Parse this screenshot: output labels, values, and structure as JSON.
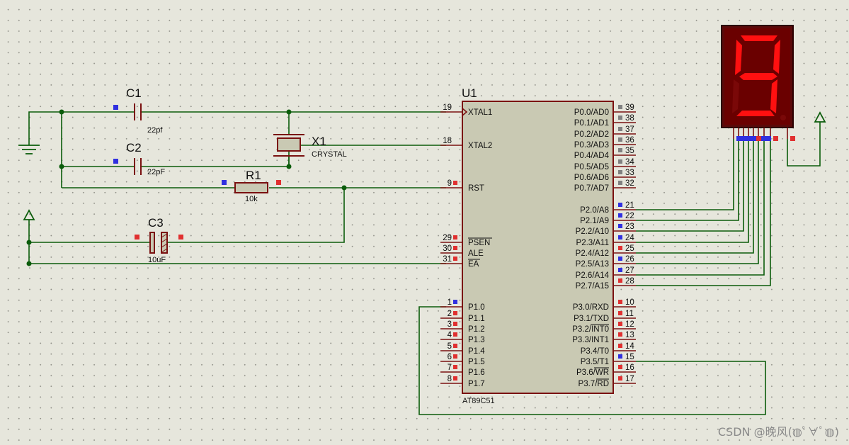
{
  "components": {
    "c1": {
      "ref": "C1",
      "value": "22pf"
    },
    "c2": {
      "ref": "C2",
      "value": "22pF"
    },
    "c3": {
      "ref": "C3",
      "value": "10uF"
    },
    "r1": {
      "ref": "R1",
      "value": "10k"
    },
    "x1": {
      "ref": "X1",
      "value": "CRYSTAL"
    },
    "u1": {
      "ref": "U1",
      "part": "AT89C51"
    }
  },
  "left_pins": [
    {
      "num": "19",
      "name": "XTAL1"
    },
    {
      "num": "18",
      "name": "XTAL2"
    },
    {
      "num": "9",
      "name": "RST"
    },
    {
      "num": "29",
      "name": "PSEN"
    },
    {
      "num": "30",
      "name": "ALE"
    },
    {
      "num": "31",
      "name": "EA"
    },
    {
      "num": "1",
      "name": "P1.0"
    },
    {
      "num": "2",
      "name": "P1.1"
    },
    {
      "num": "3",
      "name": "P1.2"
    },
    {
      "num": "4",
      "name": "P1.3"
    },
    {
      "num": "5",
      "name": "P1.4"
    },
    {
      "num": "6",
      "name": "P1.5"
    },
    {
      "num": "7",
      "name": "P1.6"
    },
    {
      "num": "8",
      "name": "P1.7"
    }
  ],
  "right_pins": [
    {
      "num": "39",
      "name": "P0.0/AD0"
    },
    {
      "num": "38",
      "name": "P0.1/AD1"
    },
    {
      "num": "37",
      "name": "P0.2/AD2"
    },
    {
      "num": "36",
      "name": "P0.3/AD3"
    },
    {
      "num": "35",
      "name": "P0.4/AD4"
    },
    {
      "num": "34",
      "name": "P0.5/AD5"
    },
    {
      "num": "33",
      "name": "P0.6/AD6"
    },
    {
      "num": "32",
      "name": "P0.7/AD7"
    },
    {
      "num": "21",
      "name": "P2.0/A8"
    },
    {
      "num": "22",
      "name": "P2.1/A9"
    },
    {
      "num": "23",
      "name": "P2.2/A10"
    },
    {
      "num": "24",
      "name": "P2.3/A11"
    },
    {
      "num": "25",
      "name": "P2.4/A12"
    },
    {
      "num": "26",
      "name": "P2.5/A13"
    },
    {
      "num": "27",
      "name": "P2.6/A14"
    },
    {
      "num": "28",
      "name": "P2.7/A15"
    },
    {
      "num": "10",
      "name": "P3.0/RXD"
    },
    {
      "num": "11",
      "name": "P3.1/TXD"
    },
    {
      "num": "12",
      "name": "P3.2/INT0"
    },
    {
      "num": "13",
      "name": "P3.3/INT1"
    },
    {
      "num": "14",
      "name": "P3.4/T0"
    },
    {
      "num": "15",
      "name": "P3.5/T1"
    },
    {
      "num": "16",
      "name": "P3.6/WR"
    },
    {
      "num": "17",
      "name": "P3.7/RD"
    }
  ],
  "display": {
    "digit": "9",
    "segment_color": "#ff1010",
    "dim_color": "#6a0000"
  },
  "colors": {
    "wire": "#0b5c0b",
    "component": "#7a1010",
    "high": "#e03030",
    "low": "#3030e0",
    "float": "#808080"
  },
  "watermark": "CSDN @晚风(◍ﾟ∀ﾟ◍)"
}
